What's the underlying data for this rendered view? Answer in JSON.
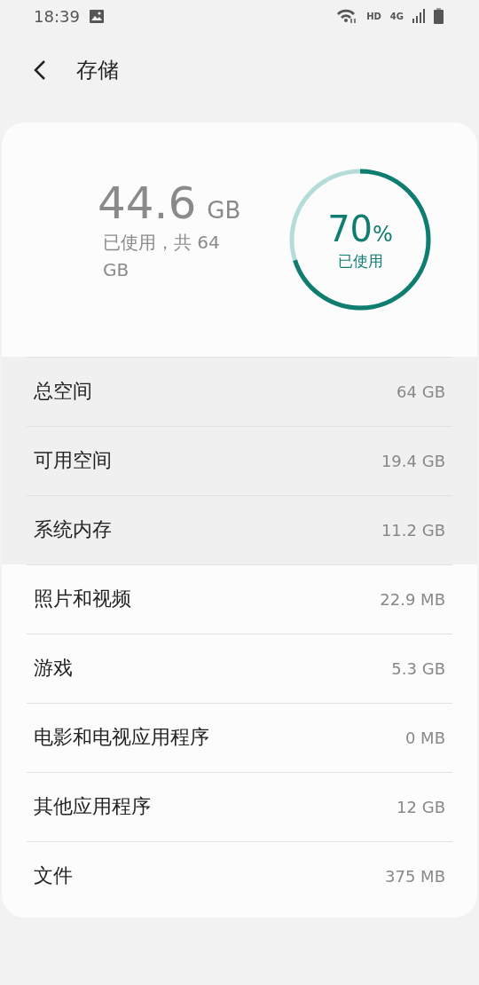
{
  "status_bar": {
    "time": "18:39",
    "network": "HD",
    "generation": "4G"
  },
  "header": {
    "title": "存储"
  },
  "summary": {
    "used": "44.6",
    "used_unit": "GB",
    "caption": "已使用，共 64 GB",
    "percent": "70",
    "percent_unit": "%",
    "percent_caption": "已使用"
  },
  "rows": [
    {
      "label": "总空间",
      "value": "64 GB",
      "highlighted": true
    },
    {
      "label": "可用空间",
      "value": "19.4 GB",
      "highlighted": true
    },
    {
      "label": "系统内存",
      "value": "11.2 GB",
      "highlighted": true
    },
    {
      "label": "照片和视频",
      "value": "22.9 MB",
      "highlighted": false
    },
    {
      "label": "游戏",
      "value": "5.3 GB",
      "highlighted": false
    },
    {
      "label": "电影和电视应用程序",
      "value": "0 MB",
      "highlighted": false
    },
    {
      "label": "其他应用程序",
      "value": "12 GB",
      "highlighted": false
    },
    {
      "label": "文件",
      "value": "375 MB",
      "highlighted": false
    }
  ]
}
